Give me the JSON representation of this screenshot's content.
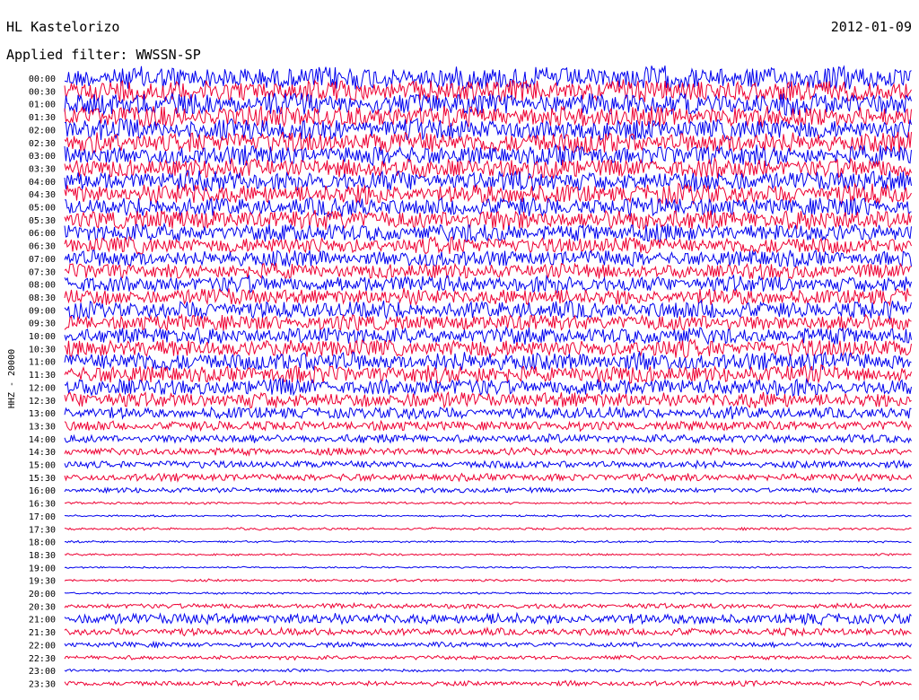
{
  "header": {
    "station": "HL Kastelorizo",
    "date": "2012-01-09",
    "filter": "Applied filter: WWSSN-SP"
  },
  "chart_data": {
    "type": "line",
    "channel_label": "HHZ - 20000",
    "trace_colors": [
      "#0000ee",
      "#ee0033"
    ],
    "row_labels": [
      "00:00",
      "00:30",
      "01:00",
      "01:30",
      "02:00",
      "02:30",
      "03:00",
      "03:30",
      "04:00",
      "04:30",
      "05:00",
      "05:30",
      "06:00",
      "06:30",
      "07:00",
      "07:30",
      "08:00",
      "08:30",
      "09:00",
      "09:30",
      "10:00",
      "10:30",
      "11:00",
      "11:30",
      "12:00",
      "12:30",
      "13:00",
      "13:30",
      "14:00",
      "14:30",
      "15:00",
      "15:30",
      "16:00",
      "16:30",
      "17:00",
      "17:30",
      "18:00",
      "18:30",
      "19:00",
      "19:30",
      "20:00",
      "20:30",
      "21:00",
      "21:30",
      "22:00",
      "22:30",
      "23:00",
      "23:30"
    ],
    "relative_amplitude": [
      1.0,
      0.95,
      0.95,
      0.9,
      0.9,
      0.9,
      0.85,
      0.85,
      0.85,
      0.85,
      0.8,
      0.85,
      0.75,
      0.7,
      0.7,
      0.65,
      0.7,
      0.7,
      0.75,
      0.7,
      0.7,
      0.75,
      0.8,
      0.75,
      0.7,
      0.65,
      0.5,
      0.4,
      0.35,
      0.3,
      0.3,
      0.3,
      0.2,
      0.08,
      0.06,
      0.08,
      0.06,
      0.06,
      0.05,
      0.08,
      0.06,
      0.2,
      0.45,
      0.3,
      0.2,
      0.15,
      0.1,
      0.2
    ]
  }
}
